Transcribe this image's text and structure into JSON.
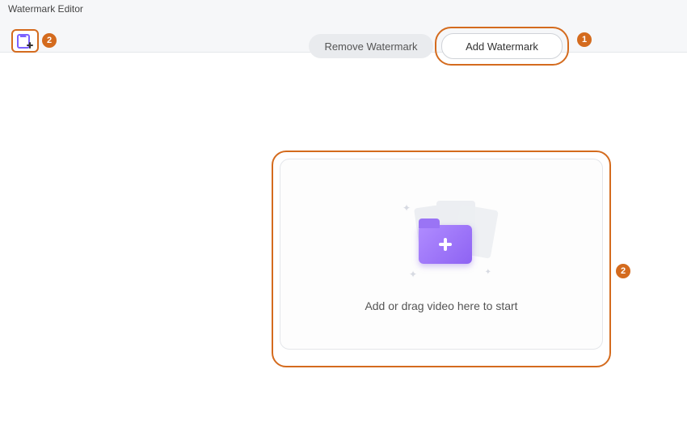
{
  "window": {
    "title": "Watermark Editor"
  },
  "tabs": {
    "remove": {
      "label": "Remove Watermark"
    },
    "add": {
      "label": "Add Watermark"
    }
  },
  "dropzone": {
    "prompt": "Add or drag video here to start"
  },
  "annotations": {
    "one": "1",
    "two_header": "2",
    "two_dropzone": "2"
  }
}
